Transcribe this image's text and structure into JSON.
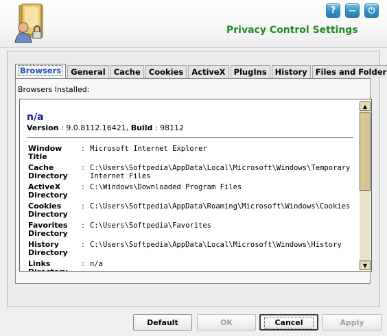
{
  "header": {
    "title": "Privacy Control Settings",
    "help_glyph": "?",
    "minimize_glyph": "—",
    "power_glyph": "⏻"
  },
  "tabs": [
    {
      "label": "Browsers",
      "active": true
    },
    {
      "label": "General"
    },
    {
      "label": "Cache"
    },
    {
      "label": "Cookies"
    },
    {
      "label": "ActiveX"
    },
    {
      "label": "PlugIns"
    },
    {
      "label": "History"
    },
    {
      "label": "Files and Folders"
    }
  ],
  "browsers_panel": {
    "installed_label": "Browsers Installed:",
    "browser_name": "n/a",
    "version_label": "Version",
    "version_value": "9.0.8112.16421",
    "build_label": "Build",
    "build_value": "98112",
    "properties": [
      {
        "key": "Window Title",
        "value": "Microsoft Internet Explorer"
      },
      {
        "key": "Cache Directory",
        "value": "C:\\Users\\Softpedia\\AppData\\Local\\Microsoft\\Windows\\Temporary Internet Files"
      },
      {
        "key": "ActiveX Directory",
        "value": "C:\\Windows\\Downloaded Program Files"
      },
      {
        "key": "Cookies Directory",
        "value": "C:\\Users\\Softpedia\\AppData\\Roaming\\Microsoft\\Windows\\Cookies"
      },
      {
        "key": "Favorites Directory",
        "value": "C:\\Users\\Softpedia\\Favorites"
      },
      {
        "key": "History Directory",
        "value": "C:\\Users\\Softpedia\\AppData\\Local\\Microsoft\\Windows\\History"
      },
      {
        "key": "Links Directory",
        "value": "n/a"
      }
    ]
  },
  "footer": {
    "default_label": "Default",
    "ok_label": "OK",
    "cancel_label": "Cancel",
    "apply_label": "Apply"
  },
  "colors": {
    "title_green": "#1f8a1f",
    "browser_name_blue": "#1b1b9a",
    "active_tab_blue": "#1f4ec2"
  }
}
